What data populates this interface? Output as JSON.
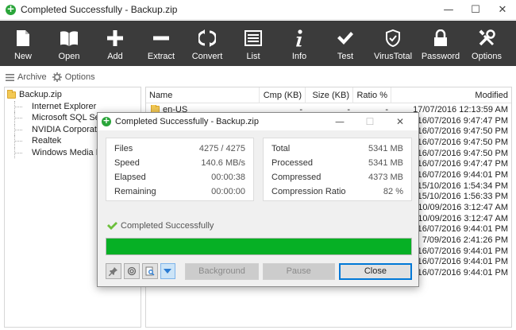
{
  "window": {
    "title": "Completed Successfully - Backup.zip",
    "minimize": "—",
    "maximize": "☐",
    "close": "✕"
  },
  "toolbar": [
    {
      "label": "New",
      "icon": "new-file-icon"
    },
    {
      "label": "Open",
      "icon": "open-book-icon"
    },
    {
      "label": "Add",
      "icon": "plus-icon"
    },
    {
      "label": "Extract",
      "icon": "minus-icon"
    },
    {
      "label": "Convert",
      "icon": "convert-arrows-icon"
    },
    {
      "label": "List",
      "icon": "list-icon"
    },
    {
      "label": "Info",
      "icon": "info-icon"
    },
    {
      "label": "Test",
      "icon": "checkmark-icon"
    },
    {
      "label": "VirusTotal",
      "icon": "shield-icon"
    },
    {
      "label": "Password",
      "icon": "lock-icon"
    },
    {
      "label": "Options",
      "icon": "tools-icon"
    }
  ],
  "subbar": {
    "archive": "Archive",
    "options": "Options"
  },
  "tree": {
    "root": "Backup.zip",
    "children": [
      "Internet Explorer",
      "Microsoft SQL Server",
      "NVIDIA Corporation",
      "Realtek",
      "Windows Media Player"
    ]
  },
  "filelist": {
    "columns": {
      "name": "Name",
      "cmp": "Cmp (KB)",
      "size": "Size (KB)",
      "ratio": "Ratio %",
      "modified": "Modified"
    },
    "rows": [
      {
        "name": "en-US",
        "cmp": "-",
        "size": "-",
        "ratio": "-",
        "modified": "17/07/2016 12:13:59 AM"
      },
      {
        "name": "",
        "modified": "16/07/2016 9:47:47 PM"
      },
      {
        "name": "",
        "modified": "16/07/2016 9:47:50 PM"
      },
      {
        "name": "",
        "modified": "16/07/2016 9:47:50 PM"
      },
      {
        "name": "",
        "modified": "16/07/2016 9:47:50 PM"
      },
      {
        "name": "",
        "modified": "16/07/2016 9:47:47 PM"
      },
      {
        "name": "",
        "modified": "16/07/2016 9:44:01 PM"
      },
      {
        "name": "",
        "modified": "15/10/2016 1:54:34 PM"
      },
      {
        "name": "",
        "modified": "15/10/2016 1:56:33 PM"
      },
      {
        "name": "",
        "modified": "10/09/2016 3:12:47 AM"
      },
      {
        "name": "",
        "modified": "10/09/2016 3:12:47 AM"
      },
      {
        "name": "",
        "modified": "16/07/2016 9:44:01 PM"
      },
      {
        "name": "",
        "modified": "7/09/2016 2:41:26 PM"
      },
      {
        "name": "",
        "modified": "16/07/2016 9:44:01 PM"
      },
      {
        "name": "",
        "modified": "16/07/2016 9:44:01 PM"
      },
      {
        "name": "",
        "modified": "16/07/2016 9:44:01 PM"
      }
    ]
  },
  "dialog": {
    "title": "Completed Successfully - Backup.zip",
    "left_stats": [
      {
        "label": "Files",
        "value": "4275 / 4275"
      },
      {
        "label": "Speed",
        "value": "140.6 MB/s"
      },
      {
        "label": "Elapsed",
        "value": "00:00:38"
      },
      {
        "label": "Remaining",
        "value": "00:00:00"
      }
    ],
    "right_stats": [
      {
        "label": "Total",
        "value": "5341 MB"
      },
      {
        "label": "Processed",
        "value": "5341 MB"
      },
      {
        "label": "Compressed",
        "value": "4373 MB"
      },
      {
        "label": "Compression Ratio",
        "value": "82  %"
      }
    ],
    "status": "Completed Successfully",
    "progress": 1.0,
    "buttons": {
      "background": "Background",
      "pause": "Pause",
      "close": "Close"
    }
  },
  "colors": {
    "toolbar_bg": "#3b3b3b",
    "progress": "#06b025",
    "accent": "#0078d7"
  }
}
